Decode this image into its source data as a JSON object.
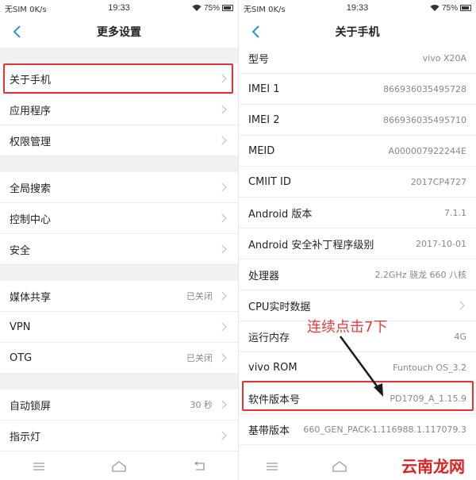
{
  "left": {
    "status": {
      "carrier": "无SIM 0K/s",
      "time": "19:33",
      "battery": "75%"
    },
    "title": "更多设置",
    "groups": [
      [
        {
          "label": "关于手机",
          "value": ""
        },
        {
          "label": "应用程序",
          "value": ""
        },
        {
          "label": "权限管理",
          "value": ""
        }
      ],
      [
        {
          "label": "全局搜索",
          "value": ""
        },
        {
          "label": "控制中心",
          "value": ""
        },
        {
          "label": "安全",
          "value": ""
        }
      ],
      [
        {
          "label": "媒体共享",
          "value": "已关闭"
        },
        {
          "label": "VPN",
          "value": ""
        },
        {
          "label": "OTG",
          "value": "已关闭"
        }
      ],
      [
        {
          "label": "自动锁屏",
          "value": "30 秒"
        },
        {
          "label": "指示灯",
          "value": ""
        }
      ]
    ]
  },
  "right": {
    "status": {
      "carrier": "无SIM 0K/s",
      "time": "19:33",
      "battery": "75%"
    },
    "title": "关于手机",
    "rows": [
      {
        "label": "型号",
        "value": "vivo X20A"
      },
      {
        "label": "IMEI 1",
        "value": "866936035495728"
      },
      {
        "label": "IMEI 2",
        "value": "866936035495710"
      },
      {
        "label": "MEID",
        "value": "A000007922244E"
      },
      {
        "label": "CMIIT ID",
        "value": "2017CP4727"
      },
      {
        "label": "Android 版本",
        "value": "7.1.1"
      },
      {
        "label": "Android 安全补丁程序级别",
        "value": "2017-10-01"
      },
      {
        "label": "处理器",
        "value": "2.2GHz 骁龙 660 八核"
      },
      {
        "label": "CPU实时数据",
        "value": ""
      },
      {
        "label": "运行内存",
        "value": "4G"
      },
      {
        "label": "vivo ROM",
        "value": "Funtouch OS_3.2"
      },
      {
        "label": "软件版本号",
        "value": "PD1709_A_1.15.9"
      },
      {
        "label": "基带版本",
        "value": "660_GEN_PACK-1.116988.1.117079.3"
      }
    ]
  },
  "annotation": {
    "text": "连续点击7下"
  },
  "watermark": {
    "text": "云南龙网"
  },
  "colors": {
    "highlight": "#e53333",
    "annotation": "#e83a3a"
  }
}
